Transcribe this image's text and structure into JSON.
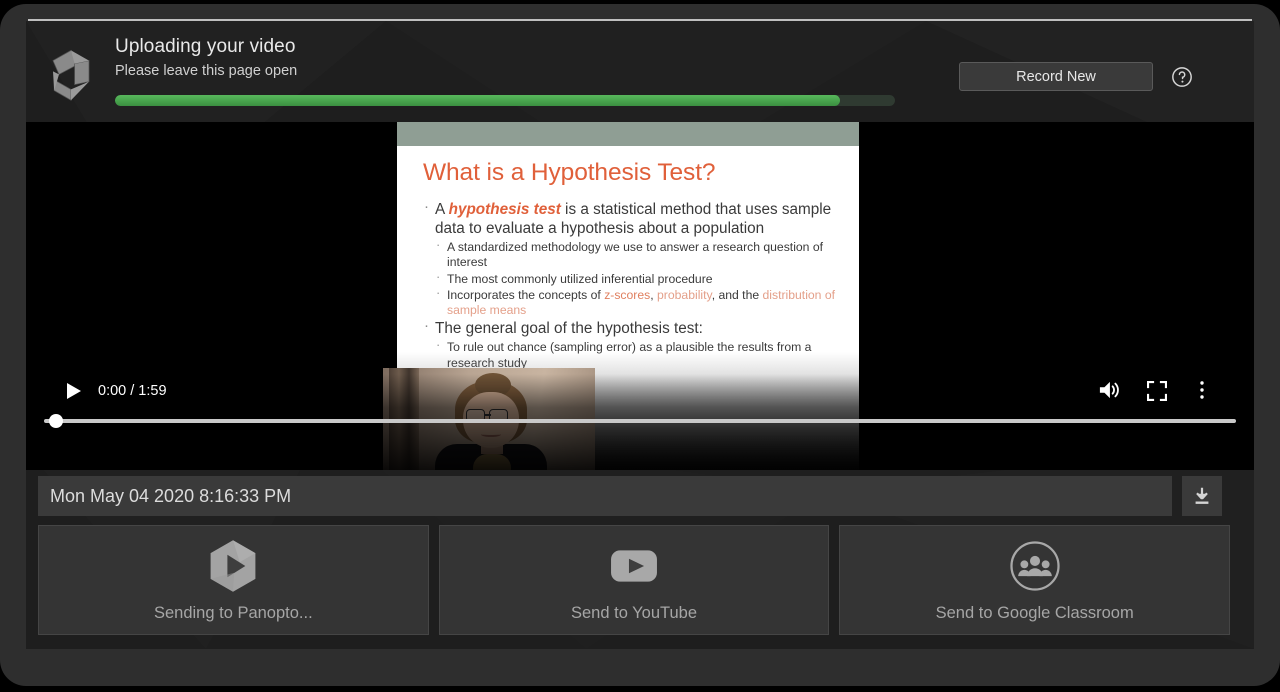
{
  "header": {
    "logo_icon": "panopto-hexagon-logo",
    "title": "Uploading your video",
    "subtitle": "Please leave this page open",
    "progress_percent": 93,
    "progress_color": "#47a34c",
    "record_new_label": "Record New",
    "help_icon": "help-circle-icon"
  },
  "player": {
    "play_icon": "play-icon",
    "current_time": "0:00",
    "time_separator": "/",
    "duration": "1:59",
    "time_display": "0:00 / 1:59",
    "seek_position_percent": 1,
    "volume_icon": "volume-icon",
    "fullscreen_icon": "fullscreen-icon",
    "more_options_icon": "kebab-menu-icon"
  },
  "slide": {
    "title": "What is a Hypothesis Test?",
    "title_color": "#e0603a",
    "header_bar_color": "#8f9e94",
    "bullets": [
      {
        "level": 1,
        "parts": [
          {
            "text": "A ",
            "style": "plain"
          },
          {
            "text": "hypothesis test",
            "style": "emphasis"
          },
          {
            "text": " is a statistical method that uses sample data to evaluate a hypothesis about a population",
            "style": "plain"
          }
        ]
      },
      {
        "level": 2,
        "parts": [
          {
            "text": "A standardized methodology we use to answer a research question of interest",
            "style": "plain"
          }
        ]
      },
      {
        "level": 2,
        "parts": [
          {
            "text": "The most commonly utilized inferential procedure",
            "style": "plain"
          }
        ]
      },
      {
        "level": 2,
        "parts": [
          {
            "text": "Incorporates the concepts of ",
            "style": "plain"
          },
          {
            "text": "z-scores",
            "style": "highlight-strong"
          },
          {
            "text": ", ",
            "style": "plain"
          },
          {
            "text": "probability",
            "style": "highlight-soft"
          },
          {
            "text": ", and the ",
            "style": "plain"
          },
          {
            "text": "distribution of sample means",
            "style": "highlight-soft"
          }
        ]
      },
      {
        "level": 1,
        "parts": [
          {
            "text": "The general goal of the hypothesis test:",
            "style": "plain"
          }
        ]
      },
      {
        "level": 2,
        "parts": [
          {
            "text": "To rule out chance (sampling error) as a plausible the results from a research study",
            "style": "plain"
          }
        ]
      }
    ]
  },
  "webcam": {
    "label": "presenter-webcam-overlay"
  },
  "filename": {
    "value": "Mon May 04 2020 8:16:33 PM",
    "placeholder": "Recording name",
    "download_icon": "download-icon"
  },
  "destinations": [
    {
      "label": "Sending to Panopto...",
      "icon": "panopto-play-hexagon-icon",
      "name": "send-to-panopto"
    },
    {
      "label": "Send to YouTube",
      "icon": "youtube-icon",
      "name": "send-to-youtube"
    },
    {
      "label": "Send to Google Classroom",
      "icon": "google-classroom-people-icon",
      "name": "send-to-google-classroom"
    }
  ]
}
